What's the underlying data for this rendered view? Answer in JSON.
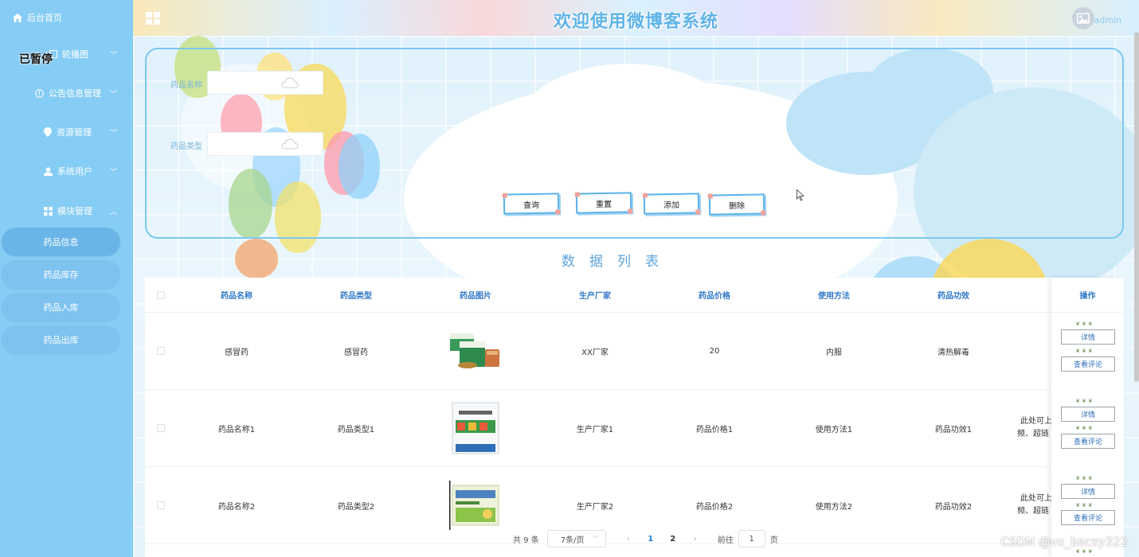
{
  "header": {
    "title": "欢迎使用微博客系统",
    "username": "admin"
  },
  "sidebar": {
    "home": "后台首页",
    "paused_overlay": "已暂停",
    "items": [
      {
        "label": "轮播图"
      },
      {
        "label": "公告信息管理"
      },
      {
        "label": "资源管理"
      },
      {
        "label": "系统用户"
      },
      {
        "label": "模块管理"
      }
    ],
    "submenu": [
      "药品信息",
      "药品库存",
      "药品入库",
      "药品出库"
    ]
  },
  "search": {
    "name_label": "药品名称",
    "type_label": "药品类型",
    "buttons": {
      "query": "查询",
      "reset": "重置",
      "add": "添加",
      "delete": "删除"
    }
  },
  "list_title": "数据列表",
  "table": {
    "columns": [
      "药品名称",
      "药品类型",
      "药品图片",
      "生产厂家",
      "药品价格",
      "使用方法",
      "药品功效",
      "操作"
    ],
    "rows": [
      {
        "name": "感冒药",
        "type": "感冒药",
        "maker": "XX厂家",
        "price": "20",
        "usage": "内服",
        "effect": "清热解毒",
        "extra1": "",
        "extra2": ""
      },
      {
        "name": "药品名称1",
        "type": "药品类型1",
        "maker": "生产厂家1",
        "price": "药品价格1",
        "usage": "使用方法1",
        "effect": "药品功效1",
        "extra1": "此处可上",
        "extra2": "频、超链"
      },
      {
        "name": "药品名称2",
        "type": "药品类型2",
        "maker": "生产厂家2",
        "price": "药品价格2",
        "usage": "使用方法2",
        "effect": "药品功效2",
        "extra1": "此处可上",
        "extra2": "频、超链"
      }
    ],
    "actions": {
      "detail": "详情",
      "comments": "查看评论"
    }
  },
  "pagination": {
    "total": "共 9 条",
    "page_size": "7条/页",
    "pages": [
      "1",
      "2"
    ],
    "current": "1",
    "goto_label": "前往",
    "goto_value": "1",
    "page_suffix": "页"
  },
  "watermark": "CSDN @vx_bscxy322",
  "colors": {
    "sidebar": "#86cdf5",
    "accent": "#5ab2ea",
    "header_text": "#2f77c6"
  }
}
